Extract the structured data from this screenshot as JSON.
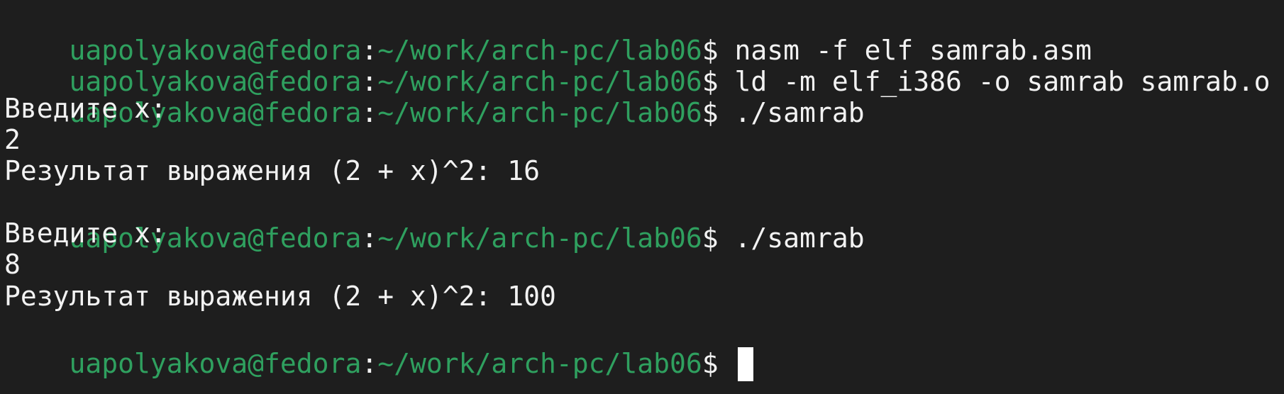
{
  "prompt": {
    "user_host": "uapolyakova@fedora",
    "separator": ":",
    "path": "~/work/arch-pc/lab06",
    "symbol": "$"
  },
  "lines": [
    {
      "type": "command",
      "text": " nasm -f elf samrab.asm"
    },
    {
      "type": "command",
      "text": " ld -m elf_i386 -o samrab samrab.o"
    },
    {
      "type": "command",
      "text": " ./samrab"
    },
    {
      "type": "output",
      "text": "Введите x:"
    },
    {
      "type": "output",
      "text": "2"
    },
    {
      "type": "output",
      "text": "Результат выражения (2 + x)^2: 16"
    },
    {
      "type": "command",
      "text": " ./samrab"
    },
    {
      "type": "output",
      "text": "Введите x:"
    },
    {
      "type": "output",
      "text": "8"
    },
    {
      "type": "output",
      "text": "Результат выражения (2 + x)^2: 100"
    },
    {
      "type": "command",
      "text": " "
    }
  ],
  "colors": {
    "background": "#1e1e1e",
    "prompt_green": "#2fa05f",
    "text": "#f2f2f2",
    "cursor": "#ffffff"
  }
}
